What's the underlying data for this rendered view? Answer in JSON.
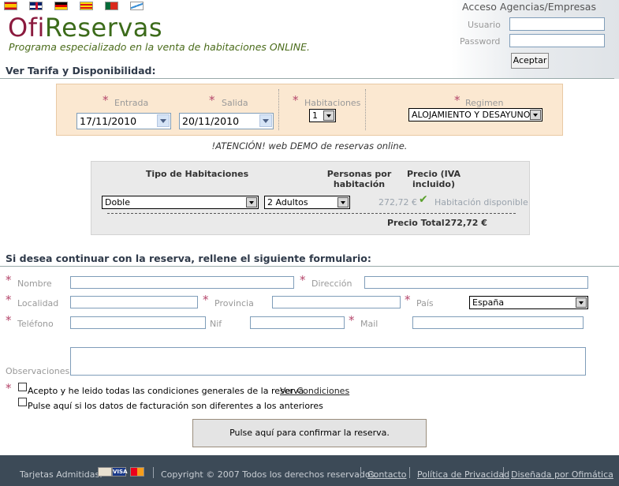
{
  "header": {
    "logo_part1": "Ofi",
    "logo_part2": "Reservas",
    "tagline": "Programa especializado en la venta de habitaciones ONLINE.",
    "languages": [
      "Español",
      "English",
      "Deutsch",
      "Català",
      "Português",
      "Galego"
    ]
  },
  "agency": {
    "title": "Acceso Agencias/Empresas",
    "user_label": "Usuario",
    "user_value": "",
    "password_label": "Password",
    "password_value": "",
    "submit_label": "Aceptar"
  },
  "availability": {
    "title": "Ver Tarifa y Disponibilidad:",
    "required_mark": "*",
    "checkin_label": "Entrada",
    "checkin_value": "17/11/2010",
    "checkout_label": "Salida",
    "checkout_value": "20/11/2010",
    "rooms_label": "Habitaciones",
    "rooms_value": "1",
    "board_label": "Regimen",
    "board_value": "ALOJAMIENTO Y DESAYUNO"
  },
  "attention": "!ATENCIÓN! web DEMO de reservas online.",
  "rooms_table": {
    "col_type": "Tipo de Habitaciones",
    "col_persons_1": "Personas por",
    "col_persons_2": "habitación",
    "col_price_1": "Precio (IVA",
    "col_price_2": "incluido)",
    "room_type": "Doble",
    "persons": "2 Adultos",
    "price": "272,72 €",
    "availability": "Habitación disponible",
    "total_label": "Precio Total",
    "total_value": "272,72 €"
  },
  "form": {
    "title": "Si desea continuar con la reserva, rellene el siguiente formulario:",
    "name_label": "Nombre",
    "address_label": "Dirección",
    "city_label": "Localidad",
    "province_label": "Provincia",
    "country_label": "País",
    "country_value": "España",
    "phone_label": "Teléfono",
    "nif_label": "Nif",
    "mail_label": "Mail",
    "notes_label": "Observaciones",
    "accept_text": "Acepto y he leido todas las condiciones generales de la reserva.",
    "conditions_link": "Ver Condiciones",
    "billing_text": "Pulse aquí si los datos de facturación son diferentes a los anteriores",
    "confirm_label": "Pulse aquí para confirmar la reserva."
  },
  "footer": {
    "cards_label": "Tarjetas Admitidas:",
    "card_visa": "VISA",
    "copyright": "Copyright © 2007 Todos los derechos reservados.",
    "contact": "Contacto",
    "privacy": "Política de Privacidad",
    "designer": "Diseñada por Ofimática"
  }
}
